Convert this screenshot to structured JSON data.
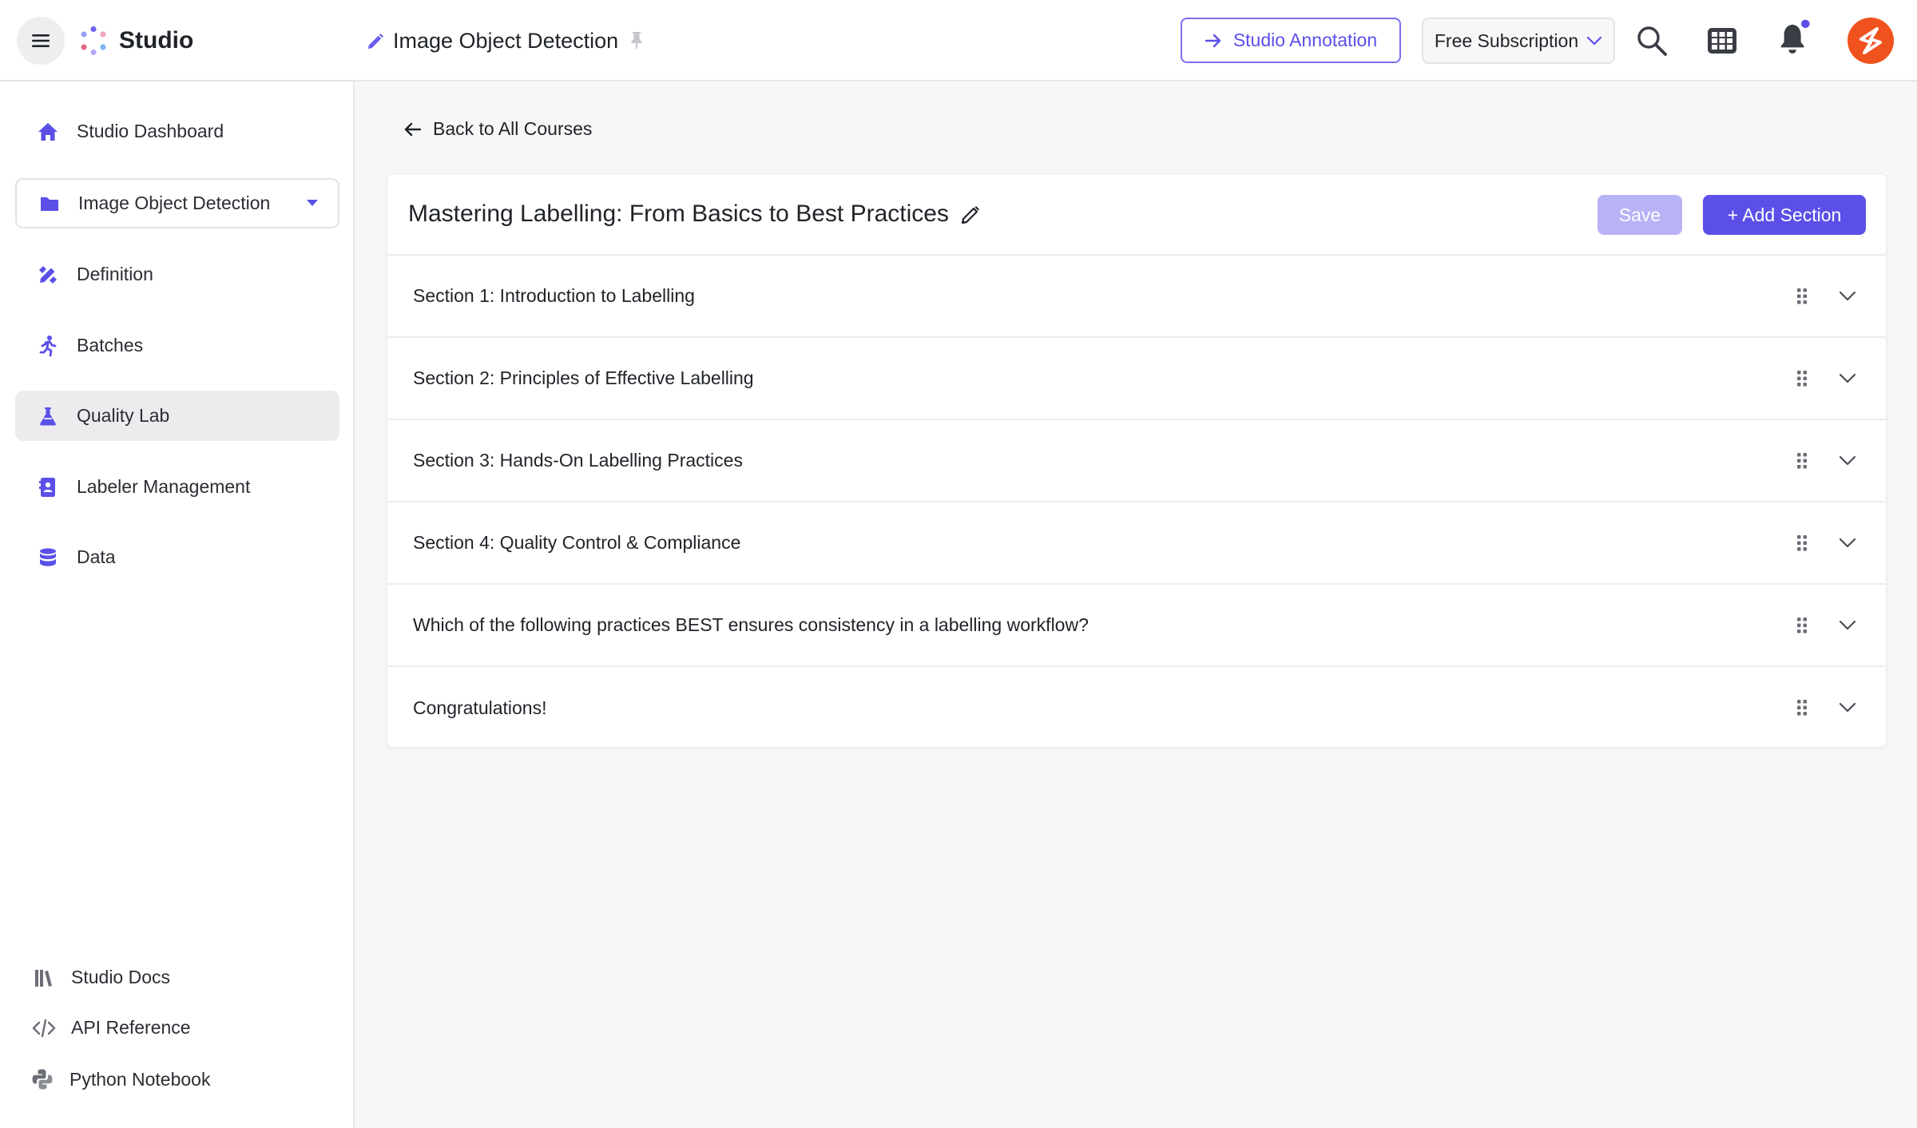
{
  "header": {
    "brand": "Studio",
    "project_title": "Image Object Detection",
    "annotation_button": "Studio Annotation",
    "subscription": "Free Subscription",
    "accent": "#5b4fe8",
    "avatar_color": "#f0521e"
  },
  "sidebar": {
    "items": [
      {
        "label": "Studio Dashboard",
        "icon": "home-icon"
      },
      {
        "label": "Image Object Detection",
        "icon": "folder-icon"
      },
      {
        "label": "Definition",
        "icon": "pencil-ruler-icon"
      },
      {
        "label": "Batches",
        "icon": "running-icon"
      },
      {
        "label": "Quality Lab",
        "icon": "flask-icon"
      },
      {
        "label": "Labeler Management",
        "icon": "contact-book-icon"
      },
      {
        "label": "Data",
        "icon": "database-icon"
      }
    ],
    "footer": [
      {
        "label": "Studio Docs",
        "icon": "library-icon"
      },
      {
        "label": "API Reference",
        "icon": "code-icon"
      },
      {
        "label": "Python Notebook",
        "icon": "python-icon"
      }
    ]
  },
  "main": {
    "back_label": "Back to All Courses",
    "course_title": "Mastering Labelling: From Basics to Best Practices",
    "save_label": "Save",
    "add_section_label": "+ Add Section",
    "sections": [
      "Section 1: Introduction to Labelling",
      "Section 2: Principles of Effective Labelling",
      "Section 3: Hands-On Labelling Practices",
      "Section 4: Quality Control & Compliance",
      "Which of the following practices BEST ensures consistency in a labelling workflow?",
      "Congratulations!"
    ]
  }
}
